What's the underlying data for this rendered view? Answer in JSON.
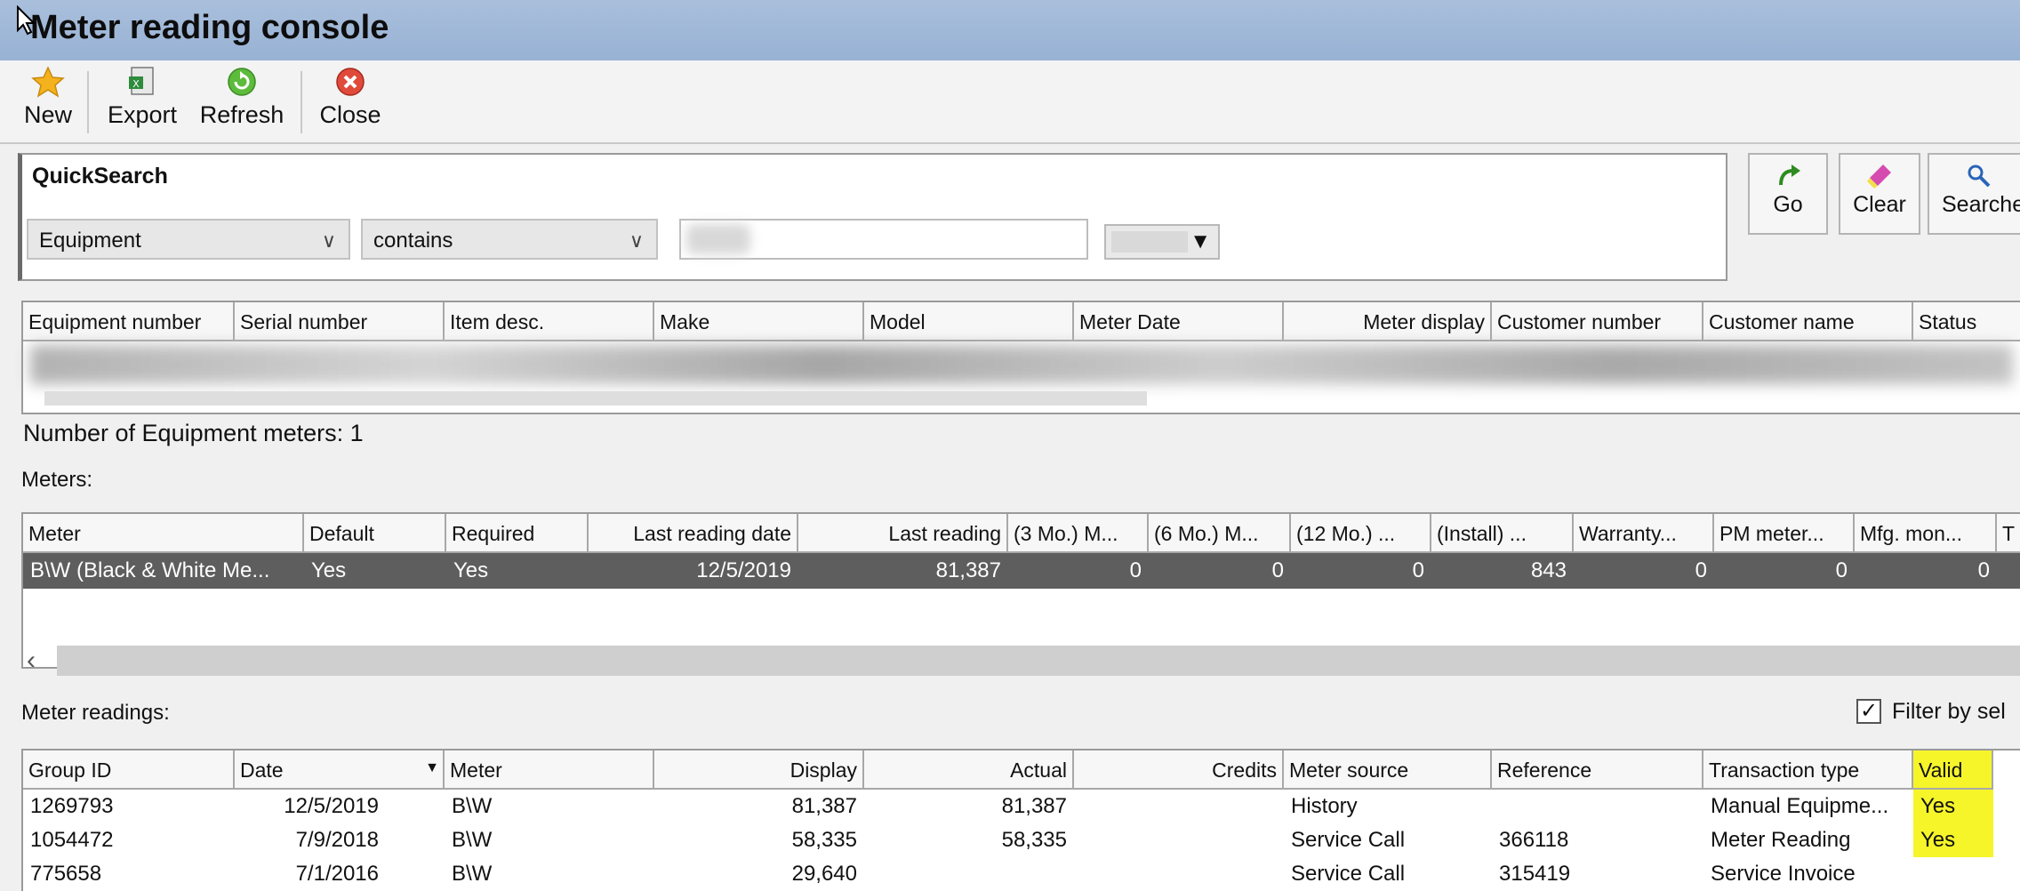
{
  "window": {
    "title": "Meter reading console"
  },
  "toolbar": {
    "new_label": "New",
    "export_label": "Export",
    "refresh_label": "Refresh",
    "close_label": "Close"
  },
  "quicksearch": {
    "title": "QuickSearch",
    "field_value": "Equipment",
    "operator_value": "contains",
    "input_value": "",
    "go_label": "Go",
    "clear_label": "Clear",
    "searches_label": "Searche"
  },
  "equipment_grid": {
    "columns": [
      "Equipment number",
      "Serial number",
      "Item desc.",
      "Make",
      "Model",
      "Meter Date",
      "Meter display",
      "Customer number",
      "Customer name",
      "Status"
    ]
  },
  "equipment_count": "Number of Equipment meters: 1",
  "meters_label": "Meters:",
  "meters_grid": {
    "columns": [
      "Meter",
      "Default",
      "Required",
      "Last reading date",
      "Last reading",
      "(3 Mo.) M...",
      "(6 Mo.) M...",
      "(12 Mo.) ...",
      "(Install) ...",
      "Warranty...",
      "PM meter...",
      "Mfg. mon...",
      "T"
    ],
    "rows": [
      [
        "B\\W (Black & White Me...",
        "Yes",
        "Yes",
        "12/5/2019",
        "81,387",
        "0",
        "0",
        "0",
        "843",
        "0",
        "0",
        "0"
      ]
    ]
  },
  "readings_label": "Meter readings:",
  "filter_label": "Filter by sel",
  "readings_grid": {
    "columns": [
      "Group ID",
      "Date",
      "Meter",
      "Display",
      "Actual",
      "Credits",
      "Meter source",
      "Reference",
      "Transaction type",
      "Valid"
    ],
    "rows": [
      [
        "1269793",
        "12/5/2019",
        "B\\W",
        "81,387",
        "81,387",
        "",
        "History",
        "",
        "Manual Equipme...",
        "Yes"
      ],
      [
        "1054472",
        "7/9/2018",
        "B\\W",
        "58,335",
        "58,335",
        "",
        "Service Call",
        "366118",
        "Meter Reading",
        "Yes"
      ],
      [
        "775658",
        "7/1/2016",
        "B\\W",
        "29,640",
        "",
        "",
        "Service Call",
        "315419",
        "Service Invoice",
        ""
      ]
    ]
  },
  "colors": {
    "title_bar": "#a9bfdc",
    "selected_row": "#5e5e5e",
    "highlight": "#f6f52a"
  }
}
